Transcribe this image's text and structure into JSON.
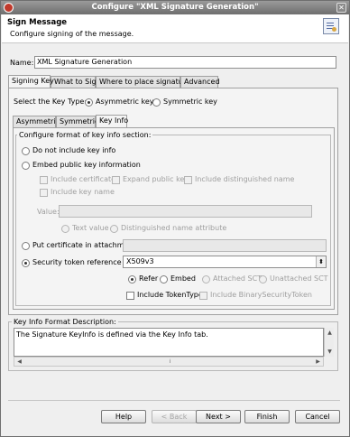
{
  "window": {
    "title": "Configure \"XML Signature Generation\""
  },
  "header": {
    "title": "Sign Message",
    "description": "Configure signing of the message."
  },
  "name_field": {
    "label": "Name:",
    "value": "XML Signature Generation"
  },
  "main_tabs": [
    "Signing Key",
    "What to Sign",
    "Where to place signature",
    "Advanced"
  ],
  "key_type": {
    "label": "Select the Key Type:",
    "asymmetric": "Asymmetric key",
    "symmetric": "Symmetric key"
  },
  "sub_tabs": [
    "Asymmetric",
    "Symmetric",
    "Key Info"
  ],
  "key_info": {
    "section_label": "Configure format of key info section:",
    "do_not_include": "Do not include key info",
    "embed_public": "Embed public key information",
    "include_certificate": "Include certificate",
    "expand_public_key": "Expand public key",
    "include_dn": "Include distinguished name",
    "include_key_name": "Include key name",
    "value_label": "Value:",
    "text_value": "Text value",
    "dn_attribute": "Distinguished name attribute",
    "put_certificate": "Put certificate in attachmen",
    "security_token": "Security token reference",
    "token_value": "X509v3",
    "refer": "Refer",
    "embed": "Embed",
    "attached_sct": "Attached SCT",
    "unattached_sct": "Unattached SCT",
    "include_token_type": "Include TokenType",
    "include_bst": "Include BinarySecurityToken"
  },
  "description_box": {
    "label": "Key Info Format Description:",
    "text": "The Signature KeyInfo is defined via the Key Info tab."
  },
  "buttons": {
    "help": "Help",
    "back": "< Back",
    "next": "Next >",
    "finish": "Finish",
    "cancel": "Cancel"
  }
}
